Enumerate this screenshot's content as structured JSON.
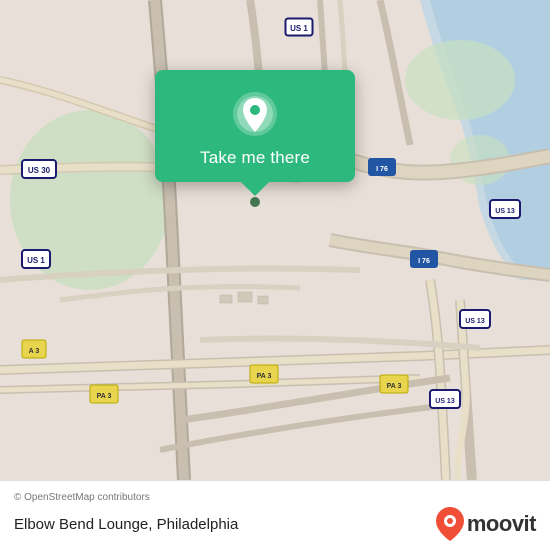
{
  "map": {
    "attribution": "© OpenStreetMap contributors",
    "popup": {
      "button_label": "Take me there",
      "pin_alt": "location pin"
    },
    "badges": [
      {
        "label": "US 1",
        "type": "us"
      },
      {
        "label": "US 30",
        "type": "us"
      },
      {
        "label": "US 1",
        "type": "us"
      },
      {
        "label": "I 76",
        "type": "interstate"
      },
      {
        "label": "I 76",
        "type": "interstate"
      },
      {
        "label": "US 13",
        "type": "us"
      },
      {
        "label": "US 13",
        "type": "us"
      },
      {
        "label": "US 13",
        "type": "us"
      },
      {
        "label": "PA 3",
        "type": "state"
      },
      {
        "label": "PA 3",
        "type": "state"
      },
      {
        "label": "PA 3",
        "type": "state"
      }
    ]
  },
  "bottom_bar": {
    "attribution": "© OpenStreetMap contributors",
    "location_name": "Elbow Bend Lounge, Philadelphia",
    "moovit_label": "moovit"
  }
}
